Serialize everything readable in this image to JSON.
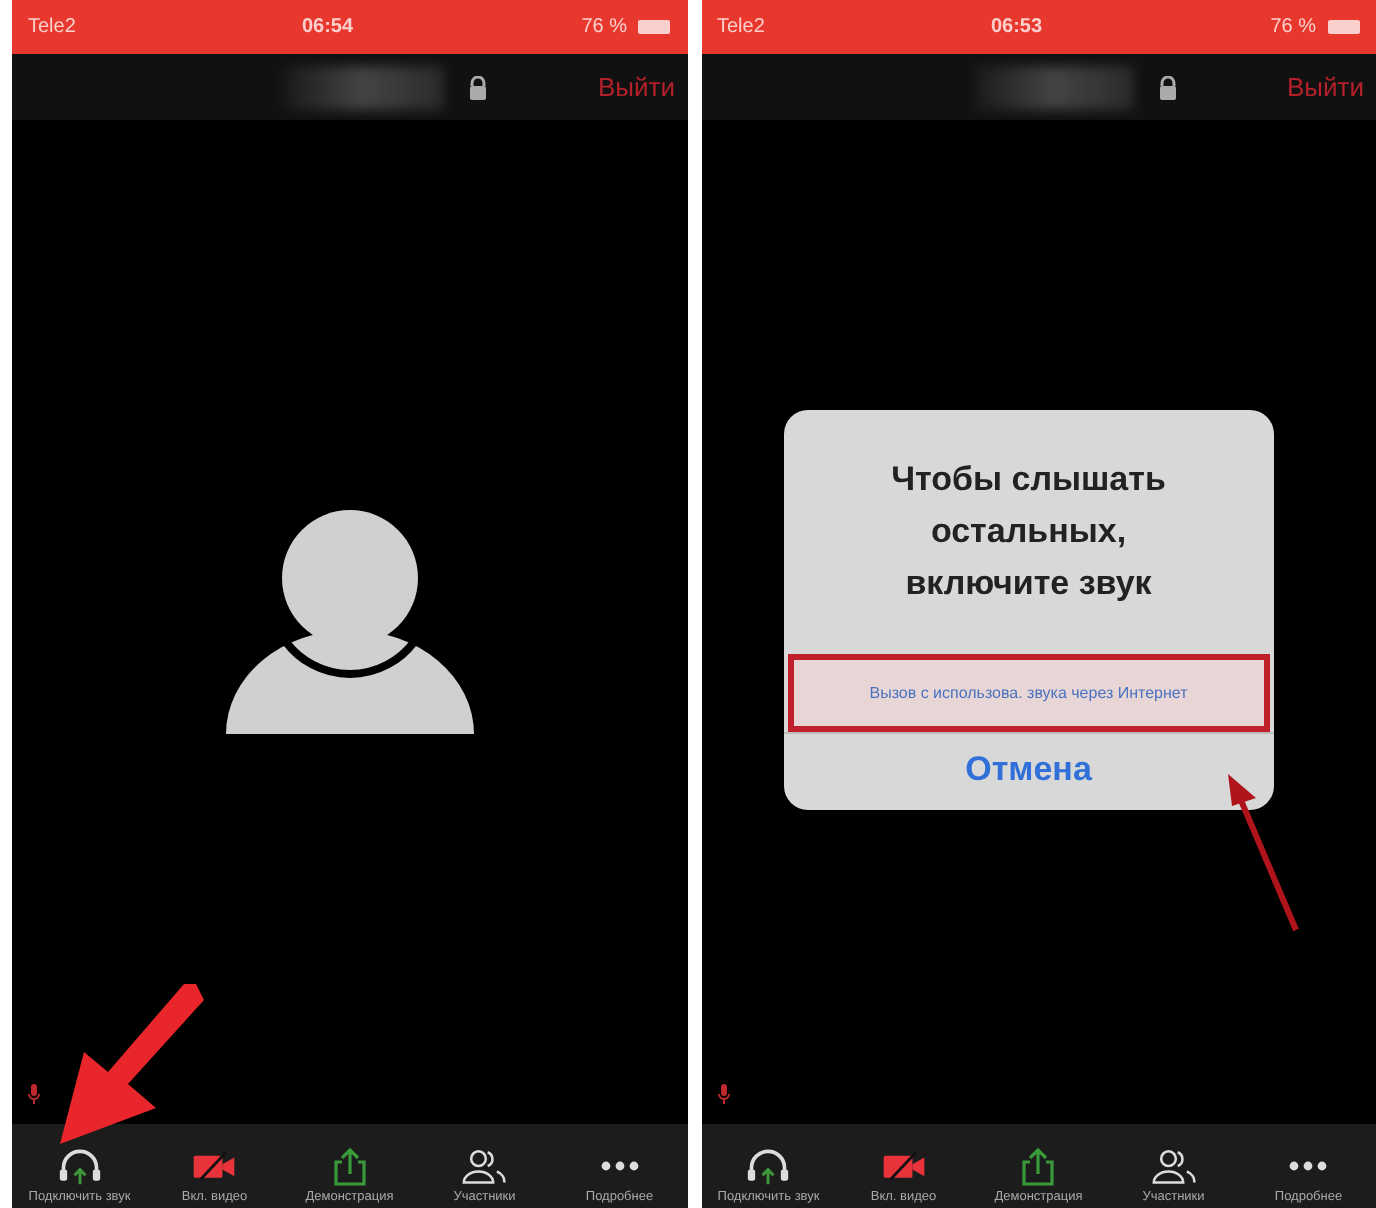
{
  "screens": [
    {
      "status_bar": {
        "carrier": "Tele2",
        "time": "06:54",
        "battery": "76 %"
      },
      "top_bar": {
        "exit": "Выйти"
      },
      "content": {
        "kind": "avatar"
      },
      "annotation": {
        "kind": "block_arrow"
      },
      "toolbar": [
        {
          "kind": "audio",
          "label": "Подключить звук"
        },
        {
          "kind": "video",
          "label": "Вкл. видео"
        },
        {
          "kind": "share",
          "label": "Демонстрация"
        },
        {
          "kind": "participants",
          "label": "Участники"
        },
        {
          "kind": "more",
          "label": "Подробнее"
        }
      ]
    },
    {
      "status_bar": {
        "carrier": "Tele2",
        "time": "06:53",
        "battery": "76 %"
      },
      "top_bar": {
        "exit": "Выйти"
      },
      "content": {
        "kind": "dialog",
        "title": "Чтобы слышать остальных, включите звук",
        "option": "Вызов с использова. звука через Интернет",
        "cancel": "Отмена"
      },
      "annotation": {
        "kind": "line_arrow"
      },
      "toolbar": [
        {
          "kind": "audio",
          "label": "Подключить звук"
        },
        {
          "kind": "video",
          "label": "Вкл. видео"
        },
        {
          "kind": "share",
          "label": "Демонстрация"
        },
        {
          "kind": "participants",
          "label": "Участники"
        },
        {
          "kind": "more",
          "label": "Подробнее"
        }
      ]
    }
  ]
}
